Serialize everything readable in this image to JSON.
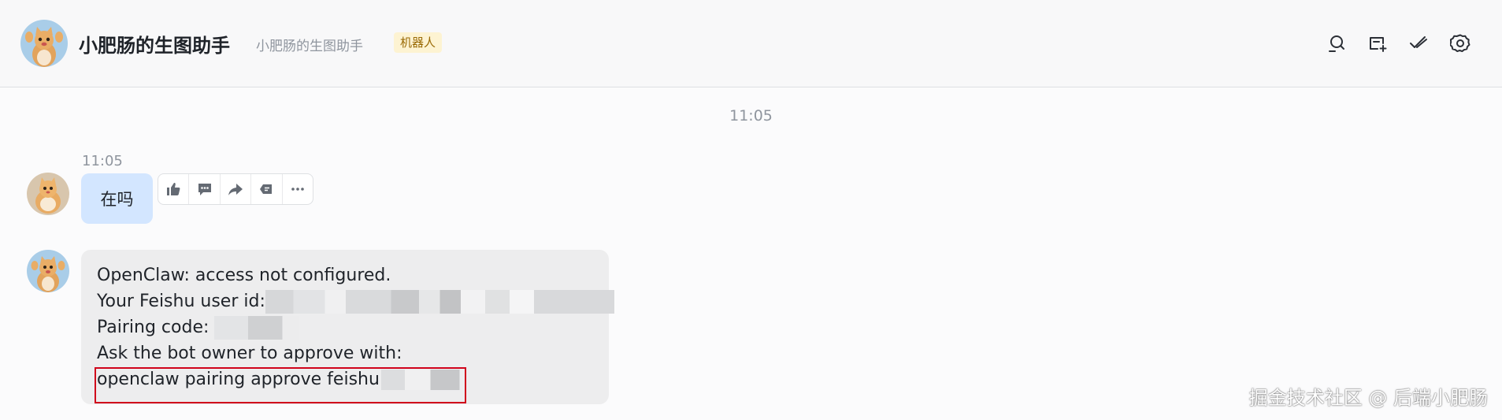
{
  "header": {
    "title": "小肥肠的生图助手",
    "subtitle": "小肥肠的生图助手",
    "badge": "机器人",
    "icons": [
      "search-chat-icon",
      "add-tab-icon",
      "task-check-icon",
      "settings-gear-icon"
    ]
  },
  "conversation": {
    "divider_time": "11:05",
    "user_message": {
      "time": "11:05",
      "text": "在吗"
    },
    "toolbar_icons": [
      "thumbs-up-icon",
      "reply-icon",
      "forward-icon",
      "pin-icon",
      "more-icon"
    ],
    "bot_message": {
      "line1": "OpenClaw: access not configured.",
      "line2_label": "Your Feishu user id:",
      "line3_label": "Pairing code:",
      "line4": "Ask the bot owner to approve with:",
      "line5_command": "openclaw pairing approve feishu"
    }
  },
  "watermark": "掘金技术社区 @ 后端小肥肠",
  "colors": {
    "user_bubble": "#d3e6ff",
    "bot_bubble": "#ededee",
    "highlight_border": "#d0021b",
    "badge_bg": "#fdf3d2"
  }
}
